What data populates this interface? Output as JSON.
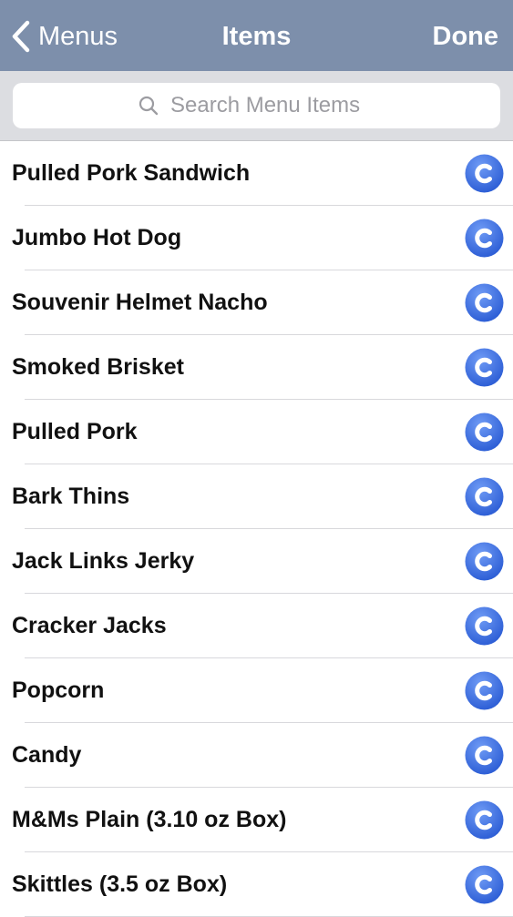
{
  "navbar": {
    "back_label": "Menus",
    "title": "Items",
    "done_label": "Done"
  },
  "search": {
    "placeholder": "Search Menu Items"
  },
  "items": [
    {
      "label": "Pulled Pork Sandwich",
      "icon": "c-badge-icon"
    },
    {
      "label": "Jumbo Hot Dog",
      "icon": "c-badge-icon"
    },
    {
      "label": "Souvenir Helmet Nacho",
      "icon": "c-badge-icon"
    },
    {
      "label": "Smoked Brisket",
      "icon": "c-badge-icon"
    },
    {
      "label": "Pulled Pork",
      "icon": "c-badge-icon"
    },
    {
      "label": "Bark Thins",
      "icon": "c-badge-icon"
    },
    {
      "label": "Jack Links Jerky",
      "icon": "c-badge-icon"
    },
    {
      "label": "Cracker Jacks",
      "icon": "c-badge-icon"
    },
    {
      "label": "Popcorn",
      "icon": "c-badge-icon"
    },
    {
      "label": "Candy",
      "icon": "c-badge-icon"
    },
    {
      "label": "M&Ms Plain (3.10 oz Box)",
      "icon": "c-badge-icon"
    },
    {
      "label": "Skittles (3.5 oz Box)",
      "icon": "c-badge-icon"
    }
  ],
  "colors": {
    "navbar": "#7d8fab",
    "search_bar": "#dcdde1",
    "badge_light": "#6f9bf5",
    "badge_dark": "#2e5fd6"
  }
}
